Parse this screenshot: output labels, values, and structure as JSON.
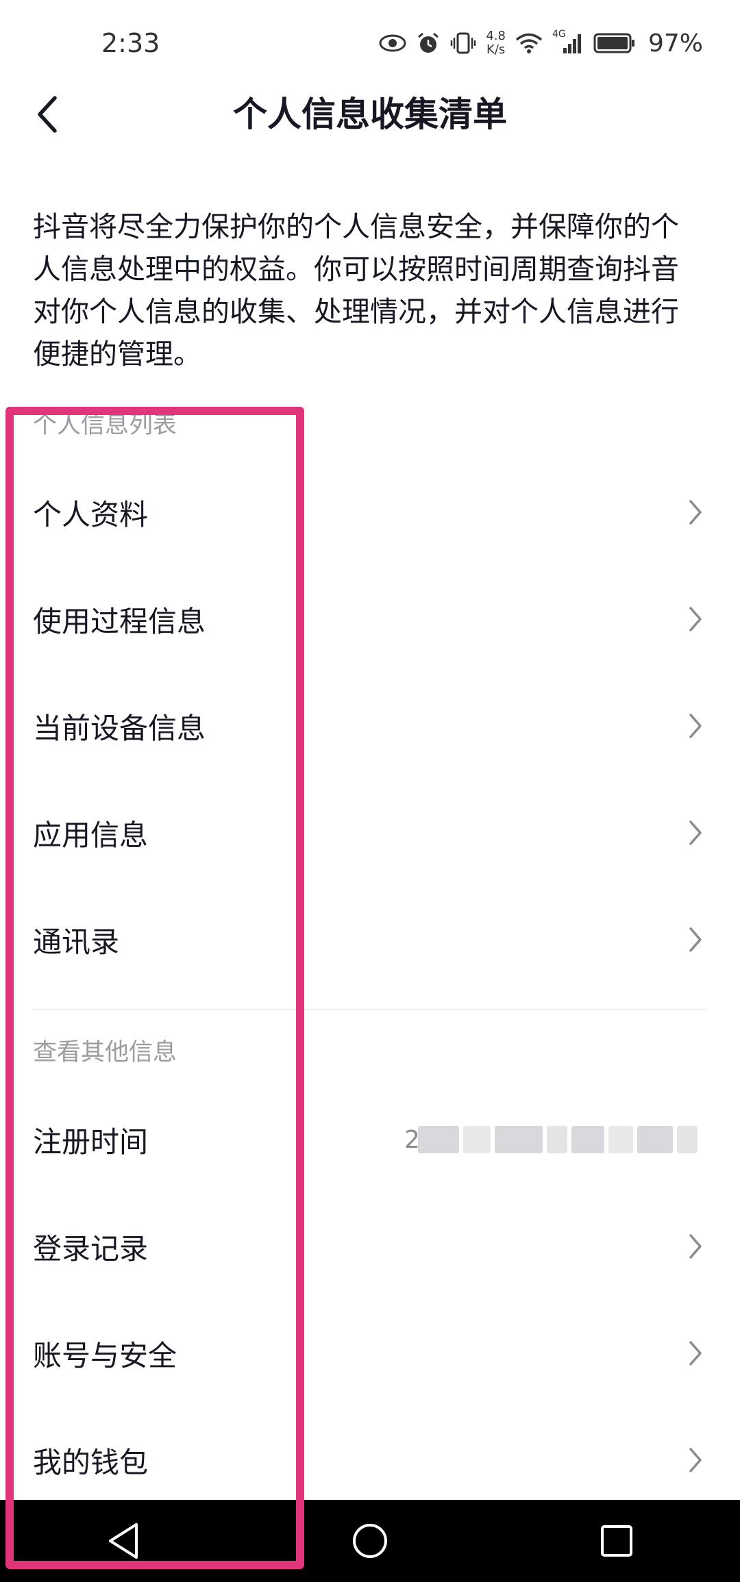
{
  "status_bar": {
    "time": "2:33",
    "net_speed_value": "4.8",
    "net_speed_unit": "K/s",
    "signal_label": "4G",
    "battery": "97%"
  },
  "header": {
    "title": "个人信息收集清单"
  },
  "intro": {
    "text": "抖音将尽全力保护你的个人信息安全，并保障你的个人信息处理中的权益。你可以按照时间周期查询抖音对你个人信息的收集、处理情况，并对个人信息进行便捷的管理。"
  },
  "section_personal": {
    "title": "个人信息列表",
    "items": [
      {
        "label": "个人资料"
      },
      {
        "label": "使用过程信息"
      },
      {
        "label": "当前设备信息"
      },
      {
        "label": "应用信息"
      },
      {
        "label": "通讯录"
      }
    ]
  },
  "section_other": {
    "title": "查看其他信息",
    "items": [
      {
        "label": "注册时间",
        "value": "2"
      },
      {
        "label": "登录记录"
      },
      {
        "label": "账号与安全"
      },
      {
        "label": "我的钱包"
      }
    ]
  },
  "colors": {
    "highlight": "#e0357a",
    "text_primary": "#161823",
    "text_secondary": "#9b9ca1"
  }
}
